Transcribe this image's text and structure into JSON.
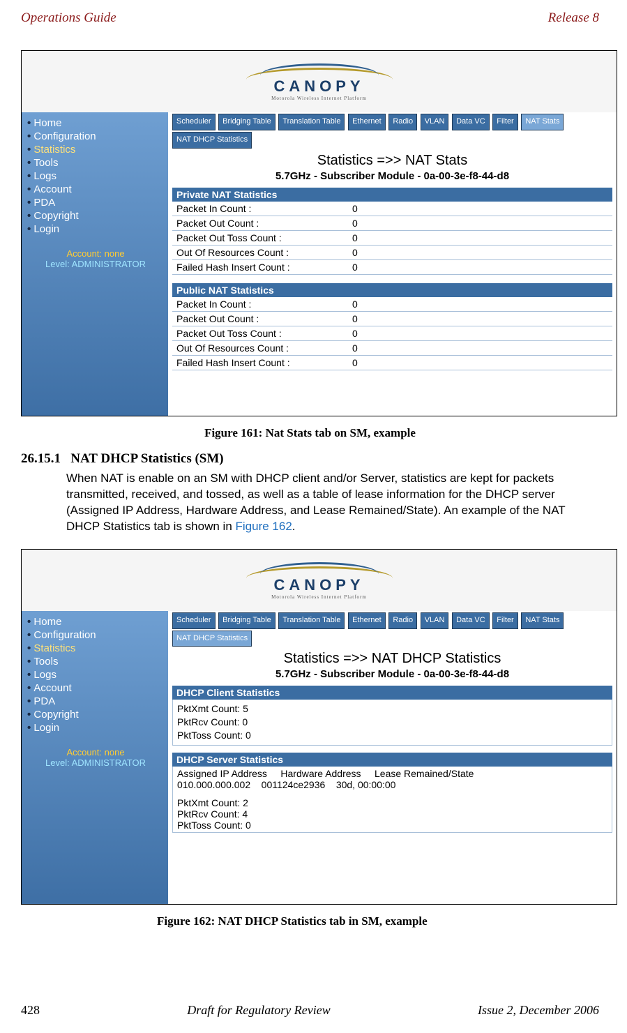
{
  "header": {
    "left": "Operations Guide",
    "right": "Release 8"
  },
  "footer": {
    "page": "428",
    "center": "Draft for Regulatory Review",
    "right": "Issue 2, December 2006"
  },
  "fig1": {
    "caption": "Figure 161: Nat Stats tab on SM, example",
    "logo": {
      "name": "CANOPY",
      "sub": "Motorola Wireless Internet Platform"
    },
    "sidebar": {
      "items": [
        "Home",
        "Configuration",
        "Statistics",
        "Tools",
        "Logs",
        "Account",
        "PDA",
        "Copyright",
        "Login"
      ],
      "active_index": 2,
      "account_line1": "Account: none",
      "account_line2": "Level: ADMINISTRATOR"
    },
    "tabs": [
      "Scheduler",
      "Bridging Table",
      "Translation Table",
      "Ethernet",
      "Radio",
      "VLAN",
      "Data VC",
      "Filter",
      "NAT Stats",
      "NAT DHCP Statistics"
    ],
    "active_tab_index": 8,
    "title": "Statistics =>> NAT Stats",
    "subtitle": "5.7GHz - Subscriber Module - 0a-00-3e-f8-44-d8",
    "sections": [
      {
        "name": "Private NAT Statistics",
        "rows": [
          {
            "label": "Packet In Count :",
            "value": "0"
          },
          {
            "label": "Packet Out Count :",
            "value": "0"
          },
          {
            "label": "Packet Out Toss Count :",
            "value": "0"
          },
          {
            "label": "Out Of Resources Count :",
            "value": "0"
          },
          {
            "label": "Failed Hash Insert Count :",
            "value": "0"
          }
        ]
      },
      {
        "name": "Public NAT Statistics",
        "rows": [
          {
            "label": "Packet In Count :",
            "value": "0"
          },
          {
            "label": "Packet Out Count :",
            "value": "0"
          },
          {
            "label": "Packet Out Toss Count :",
            "value": "0"
          },
          {
            "label": "Out Of Resources Count :",
            "value": "0"
          },
          {
            "label": "Failed Hash Insert Count :",
            "value": "0"
          }
        ]
      }
    ]
  },
  "section": {
    "number": "26.15.1",
    "title": "NAT DHCP Statistics (SM)",
    "body_pre": "When NAT is enable on an SM with DHCP client and/or Server, statistics are kept for packets transmitted, received, and tossed, as well as a table of lease information for the DHCP server (Assigned IP Address, Hardware Address, and Lease Remained/State). An example of the NAT DHCP Statistics tab is shown in ",
    "figref": "Figure 162",
    "body_post": "."
  },
  "fig2": {
    "caption": "Figure 162: NAT DHCP Statistics tab in SM, example",
    "logo": {
      "name": "CANOPY",
      "sub": "Motorola Wireless Internet Platform"
    },
    "sidebar": {
      "items": [
        "Home",
        "Configuration",
        "Statistics",
        "Tools",
        "Logs",
        "Account",
        "PDA",
        "Copyright",
        "Login"
      ],
      "active_index": 2,
      "account_line1": "Account: none",
      "account_line2": "Level: ADMINISTRATOR"
    },
    "tabs": [
      "Scheduler",
      "Bridging Table",
      "Translation Table",
      "Ethernet",
      "Radio",
      "VLAN",
      "Data VC",
      "Filter",
      "NAT Stats",
      "NAT DHCP Statistics"
    ],
    "active_tab_index": 9,
    "title": "Statistics =>> NAT DHCP Statistics",
    "subtitle": "5.7GHz - Subscriber Module - 0a-00-3e-f8-44-d8",
    "client": {
      "header": "DHCP Client Statistics",
      "lines": [
        "PktXmt Count: 5",
        "PktRcv Count: 0",
        "PktToss Count: 0"
      ]
    },
    "server": {
      "header": "DHCP Server Statistics",
      "columns_line": "Assigned IP Address     Hardware Address     Lease Remained/State",
      "data_line": "010.000.000.002    001124ce2936    30d, 00:00:00",
      "lines": [
        "PktXmt Count: 2",
        "PktRcv Count: 4",
        "PktToss Count: 0"
      ]
    }
  }
}
